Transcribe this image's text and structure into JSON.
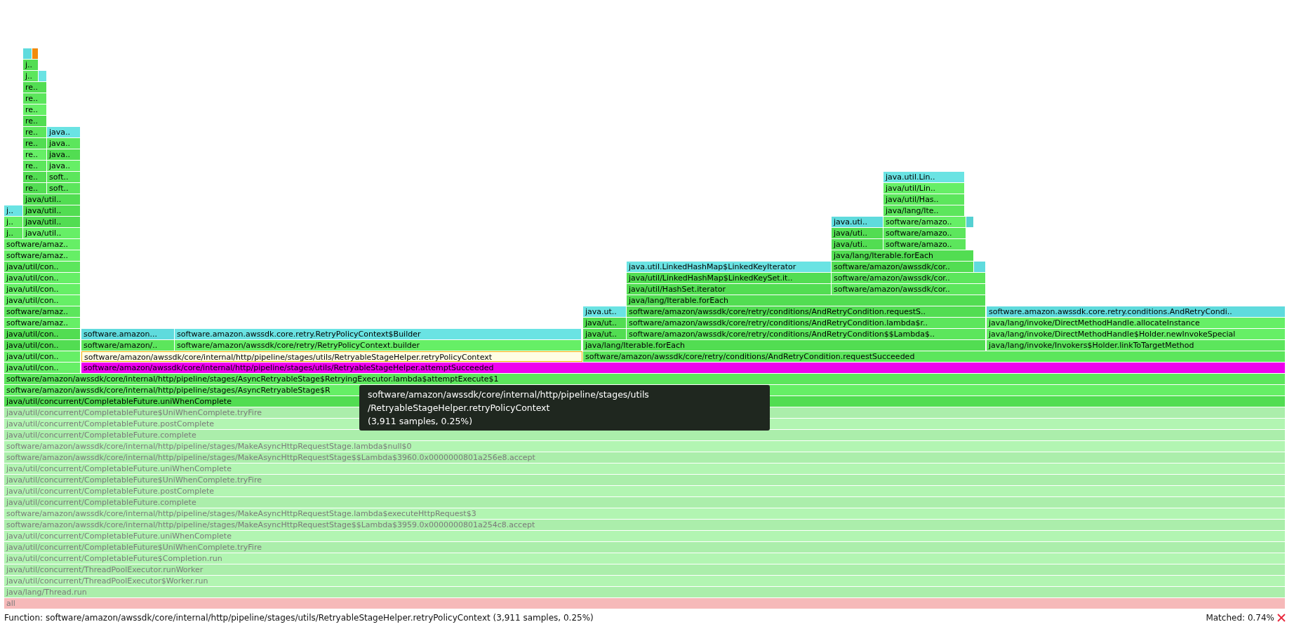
{
  "frames": [
    {
      "kind": "inlined",
      "faded": false,
      "matched": false,
      "hovered": false
    },
    {
      "kind": "kernel",
      "faded": false,
      "matched": false,
      "hovered": false
    },
    {
      "label": "j..",
      "kind": "java",
      "faded": false,
      "matched": false,
      "hovered": false
    },
    {
      "label": "j..",
      "kind": "java",
      "faded": false,
      "matched": false,
      "hovered": false
    },
    {
      "kind": "inlined",
      "faded": false,
      "matched": false,
      "hovered": false
    },
    {
      "label": "re..",
      "kind": "java",
      "faded": false,
      "matched": false,
      "hovered": false
    },
    {
      "label": "re..",
      "kind": "java",
      "faded": false,
      "matched": false,
      "hovered": false
    },
    {
      "label": "re..",
      "kind": "java",
      "faded": false,
      "matched": false,
      "hovered": false
    },
    {
      "label": "re..",
      "kind": "java",
      "faded": false,
      "matched": false,
      "hovered": false
    },
    {
      "label": "re..",
      "kind": "java",
      "faded": false,
      "matched": false,
      "hovered": false
    },
    {
      "label": "java..",
      "kind": "inlined",
      "faded": false,
      "matched": false,
      "hovered": false
    },
    {
      "label": "re..",
      "kind": "java",
      "faded": false,
      "matched": false,
      "hovered": false
    },
    {
      "label": "java..",
      "kind": "java",
      "faded": false,
      "matched": false,
      "hovered": false
    },
    {
      "label": "re..",
      "kind": "java",
      "faded": false,
      "matched": false,
      "hovered": false
    },
    {
      "label": "java..",
      "kind": "java",
      "faded": false,
      "matched": false,
      "hovered": false
    },
    {
      "label": "re..",
      "kind": "java",
      "faded": false,
      "matched": false,
      "hovered": false
    },
    {
      "label": "java..",
      "kind": "java",
      "faded": false,
      "matched": false,
      "hovered": false
    },
    {
      "label": "re..",
      "kind": "java",
      "faded": false,
      "matched": false,
      "hovered": false
    },
    {
      "label": "soft..",
      "kind": "java",
      "faded": false,
      "matched": false,
      "hovered": false
    },
    {
      "label": "java.util.Lin..",
      "kind": "inlined",
      "faded": false,
      "matched": false,
      "hovered": false
    },
    {
      "label": "re..",
      "kind": "java",
      "faded": false,
      "matched": false,
      "hovered": false
    },
    {
      "label": "soft..",
      "kind": "java",
      "faded": false,
      "matched": false,
      "hovered": false
    },
    {
      "label": "java/util/Lin..",
      "kind": "java",
      "faded": false,
      "matched": false,
      "hovered": false
    },
    {
      "label": "java/util..",
      "kind": "java",
      "faded": false,
      "matched": false,
      "hovered": false
    },
    {
      "label": "java/util/Has..",
      "kind": "java",
      "faded": false,
      "matched": false,
      "hovered": false
    },
    {
      "label": "j..",
      "kind": "inlined",
      "faded": false,
      "matched": false,
      "hovered": false
    },
    {
      "label": "java/util..",
      "kind": "java",
      "faded": false,
      "matched": false,
      "hovered": false
    },
    {
      "label": "java/lang/Ite..",
      "kind": "java",
      "faded": false,
      "matched": false,
      "hovered": false
    },
    {
      "label": "j..",
      "kind": "java",
      "faded": false,
      "matched": false,
      "hovered": false
    },
    {
      "label": "java/util..",
      "kind": "java",
      "faded": false,
      "matched": false,
      "hovered": false
    },
    {
      "label": "java.uti..",
      "kind": "inlined",
      "faded": false,
      "matched": false,
      "hovered": false
    },
    {
      "label": "software/amazo..",
      "kind": "java",
      "faded": false,
      "matched": false,
      "hovered": false
    },
    {
      "kind": "inlined",
      "faded": false,
      "matched": false,
      "hovered": false
    },
    {
      "label": "j..",
      "kind": "java",
      "faded": false,
      "matched": false,
      "hovered": false
    },
    {
      "label": "java/util..",
      "kind": "java",
      "faded": false,
      "matched": false,
      "hovered": false
    },
    {
      "label": "java/uti..",
      "kind": "java",
      "faded": false,
      "matched": false,
      "hovered": false
    },
    {
      "label": "software/amazo..",
      "kind": "java",
      "faded": false,
      "matched": false,
      "hovered": false
    },
    {
      "label": "software/amaz..",
      "kind": "java",
      "faded": false,
      "matched": false,
      "hovered": false
    },
    {
      "label": "java/uti..",
      "kind": "java",
      "faded": false,
      "matched": false,
      "hovered": false
    },
    {
      "label": "software/amazo..",
      "kind": "java",
      "faded": false,
      "matched": false,
      "hovered": false
    },
    {
      "label": "software/amaz..",
      "kind": "java",
      "faded": false,
      "matched": false,
      "hovered": false
    },
    {
      "label": "java/lang/Iterable.forEach",
      "kind": "java",
      "faded": false,
      "matched": false,
      "hovered": false
    },
    {
      "label": "java/util/con..",
      "kind": "java",
      "faded": false,
      "matched": false,
      "hovered": false
    },
    {
      "label": "java.util.LinkedHashMap$LinkedKeyIterator",
      "kind": "inlined",
      "faded": false,
      "matched": false,
      "hovered": false
    },
    {
      "label": "software/amazon/awssdk/cor..",
      "kind": "java",
      "faded": false,
      "matched": false,
      "hovered": false
    },
    {
      "kind": "inlined",
      "faded": false,
      "matched": false,
      "hovered": false
    },
    {
      "label": "java/util/con..",
      "kind": "java",
      "faded": false,
      "matched": false,
      "hovered": false
    },
    {
      "label": "java/util/LinkedHashMap$LinkedKeySet.it..",
      "kind": "java",
      "faded": false,
      "matched": false,
      "hovered": false
    },
    {
      "label": "software/amazon/awssdk/cor..",
      "kind": "java",
      "faded": false,
      "matched": false,
      "hovered": false
    },
    {
      "label": "java/util/con..",
      "kind": "java",
      "faded": false,
      "matched": false,
      "hovered": false
    },
    {
      "label": "java/util/HashSet.iterator",
      "kind": "java",
      "faded": false,
      "matched": false,
      "hovered": false
    },
    {
      "label": "software/amazon/awssdk/cor..",
      "kind": "java",
      "faded": false,
      "matched": false,
      "hovered": false
    },
    {
      "label": "java/util/con..",
      "kind": "java",
      "faded": false,
      "matched": false,
      "hovered": false
    },
    {
      "label": "java/lang/Iterable.forEach",
      "kind": "java",
      "faded": false,
      "matched": false,
      "hovered": false
    },
    {
      "label": "software/amaz..",
      "kind": "java",
      "faded": false,
      "matched": false,
      "hovered": false
    },
    {
      "label": "java.ut..",
      "kind": "inlined",
      "faded": false,
      "matched": false,
      "hovered": false
    },
    {
      "label": "software/amazon/awssdk/core/retry/conditions/AndRetryCondition.requestS..",
      "kind": "java",
      "faded": false,
      "matched": false,
      "hovered": false
    },
    {
      "label": "software.amazon.awssdk.core.retry.conditions.AndRetryCondi..",
      "kind": "inlined",
      "faded": false,
      "matched": false,
      "hovered": false
    },
    {
      "label": "software/amaz..",
      "kind": "java",
      "faded": false,
      "matched": false,
      "hovered": false
    },
    {
      "label": "java/ut..",
      "kind": "java",
      "faded": false,
      "matched": false,
      "hovered": false
    },
    {
      "label": "software/amazon/awssdk/core/retry/conditions/AndRetryCondition.lambda$r..",
      "kind": "java",
      "faded": false,
      "matched": false,
      "hovered": false
    },
    {
      "label": "java/lang/invoke/DirectMethodHandle.allocateInstance",
      "kind": "java",
      "faded": false,
      "matched": false,
      "hovered": false
    },
    {
      "label": "java/util/con..",
      "kind": "java",
      "faded": false,
      "matched": false,
      "hovered": false
    },
    {
      "label": "software.amazon...",
      "kind": "inlined",
      "faded": false,
      "matched": false,
      "hovered": false
    },
    {
      "label": "software.amazon.awssdk.core.retry.RetryPolicyContext$Builder",
      "kind": "inlined",
      "faded": false,
      "matched": false,
      "hovered": false
    },
    {
      "label": "java/ut..",
      "kind": "java",
      "faded": false,
      "matched": false,
      "hovered": false
    },
    {
      "label": "software/amazon/awssdk/core/retry/conditions/AndRetryCondition$$Lambda$..",
      "kind": "java",
      "faded": false,
      "matched": false,
      "hovered": false
    },
    {
      "label": "java/lang/invoke/DirectMethodHandle$Holder.newInvokeSpecial",
      "kind": "java",
      "faded": false,
      "matched": false,
      "hovered": false
    },
    {
      "label": "java/util/con..",
      "kind": "java",
      "faded": false,
      "matched": false,
      "hovered": false
    },
    {
      "label": "software/amazon/..",
      "kind": "java",
      "faded": false,
      "matched": false,
      "hovered": false
    },
    {
      "label": "software/amazon/awssdk/core/retry/RetryPolicyContext.builder",
      "kind": "java",
      "faded": false,
      "matched": false,
      "hovered": false
    },
    {
      "label": "java/lang/Iterable.forEach",
      "kind": "java",
      "faded": false,
      "matched": false,
      "hovered": false
    },
    {
      "label": "java/lang/invoke/Invokers$Holder.linkToTargetMethod",
      "kind": "java",
      "faded": false,
      "matched": false,
      "hovered": false
    },
    {
      "label": "java/util/con..",
      "kind": "java",
      "faded": false,
      "matched": false,
      "hovered": false
    },
    {
      "label": "software/amazon/awssdk/core/internal/http/pipeline/stages/utils/RetryableStageHelper.retryPolicyContext",
      "kind": "java",
      "faded": false,
      "matched": false,
      "hovered": true
    },
    {
      "label": "software/amazon/awssdk/core/retry/conditions/AndRetryCondition.requestSucceeded",
      "kind": "java",
      "faded": false,
      "matched": false,
      "hovered": false
    },
    {
      "label": "java/util/con..",
      "kind": "java",
      "faded": false,
      "matched": false,
      "hovered": false
    },
    {
      "label": "software/amazon/awssdk/core/internal/http/pipeline/stages/utils/RetryableStageHelper.attemptSucceeded",
      "kind": "java",
      "faded": false,
      "matched": true,
      "hovered": false
    },
    {
      "label": "software/amazon/awssdk/core/internal/http/pipeline/stages/AsyncRetryableStage$RetryingExecutor.lambda$attemptExecute$1",
      "kind": "java",
      "faded": false,
      "matched": false,
      "hovered": false
    },
    {
      "label": "software/amazon/awssdk/core/internal/http/pipeline/stages/AsyncRetryableStage$R",
      "kind": "java",
      "faded": false,
      "matched": false,
      "hovered": false
    },
    {
      "label": "java/util/concurrent/CompletableFuture.uniWhenComplete",
      "kind": "java",
      "faded": false,
      "matched": false,
      "hovered": false
    },
    {
      "label": "java/util/concurrent/CompletableFuture$UniWhenComplete.tryFire",
      "kind": "java",
      "faded": true,
      "matched": false,
      "hovered": false
    },
    {
      "label": "java/util/concurrent/CompletableFuture.postComplete",
      "kind": "java",
      "faded": true,
      "matched": false,
      "hovered": false
    },
    {
      "label": "java/util/concurrent/CompletableFuture.complete",
      "kind": "java",
      "faded": true,
      "matched": false,
      "hovered": false
    },
    {
      "label": "software/amazon/awssdk/core/internal/http/pipeline/stages/MakeAsyncHttpRequestStage.lambda$null$0",
      "kind": "java",
      "faded": true,
      "matched": false,
      "hovered": false
    },
    {
      "label": "software/amazon/awssdk/core/internal/http/pipeline/stages/MakeAsyncHttpRequestStage$$Lambda$3960.0x0000000801a256e8.accept",
      "kind": "java",
      "faded": true,
      "matched": false,
      "hovered": false
    },
    {
      "label": "java/util/concurrent/CompletableFuture.uniWhenComplete",
      "kind": "java",
      "faded": true,
      "matched": false,
      "hovered": false
    },
    {
      "label": "java/util/concurrent/CompletableFuture$UniWhenComplete.tryFire",
      "kind": "java",
      "faded": true,
      "matched": false,
      "hovered": false
    },
    {
      "label": "java/util/concurrent/CompletableFuture.postComplete",
      "kind": "java",
      "faded": true,
      "matched": false,
      "hovered": false
    },
    {
      "label": "java/util/concurrent/CompletableFuture.complete",
      "kind": "java",
      "faded": true,
      "matched": false,
      "hovered": false
    },
    {
      "label": "software/amazon/awssdk/core/internal/http/pipeline/stages/MakeAsyncHttpRequestStage.lambda$executeHttpRequest$3",
      "kind": "java",
      "faded": true,
      "matched": false,
      "hovered": false
    },
    {
      "label": "software/amazon/awssdk/core/internal/http/pipeline/stages/MakeAsyncHttpRequestStage$$Lambda$3959.0x0000000801a254c8.accept",
      "kind": "java",
      "faded": true,
      "matched": false,
      "hovered": false
    },
    {
      "label": "java/util/concurrent/CompletableFuture.uniWhenComplete",
      "kind": "java",
      "faded": true,
      "matched": false,
      "hovered": false
    },
    {
      "label": "java/util/concurrent/CompletableFuture$UniWhenComplete.tryFire",
      "kind": "java",
      "faded": true,
      "matched": false,
      "hovered": false
    },
    {
      "label": "java/util/concurrent/CompletableFuture$Completion.run",
      "kind": "java",
      "faded": true,
      "matched": false,
      "hovered": false
    },
    {
      "label": "java/util/concurrent/ThreadPoolExecutor.runWorker",
      "kind": "java",
      "faded": true,
      "matched": false,
      "hovered": false
    },
    {
      "label": "java/util/concurrent/ThreadPoolExecutor$Worker.run",
      "kind": "java",
      "faded": true,
      "matched": false,
      "hovered": false
    },
    {
      "label": "java/lang/Thread.run",
      "kind": "java",
      "faded": true,
      "matched": false,
      "hovered": false
    },
    {
      "label": "all",
      "kind": "root",
      "faded": true,
      "matched": false,
      "hovered": false
    }
  ],
  "tooltip": {
    "lines": [
      "software/amazon/awssdk/core/internal/http/pipeline/stages/utils",
      "/RetryableStageHelper.retryPolicyContext"
    ],
    "stats": "(3,911 samples, 0.25%)"
  },
  "status_bar": {
    "function": "Function: software/amazon/awssdk/core/internal/http/pipeline/stages/utils/RetryableStageHelper.retryPolicyContext (3,911 samples, 0.25%)",
    "matched": "Matched: 0.74%"
  }
}
